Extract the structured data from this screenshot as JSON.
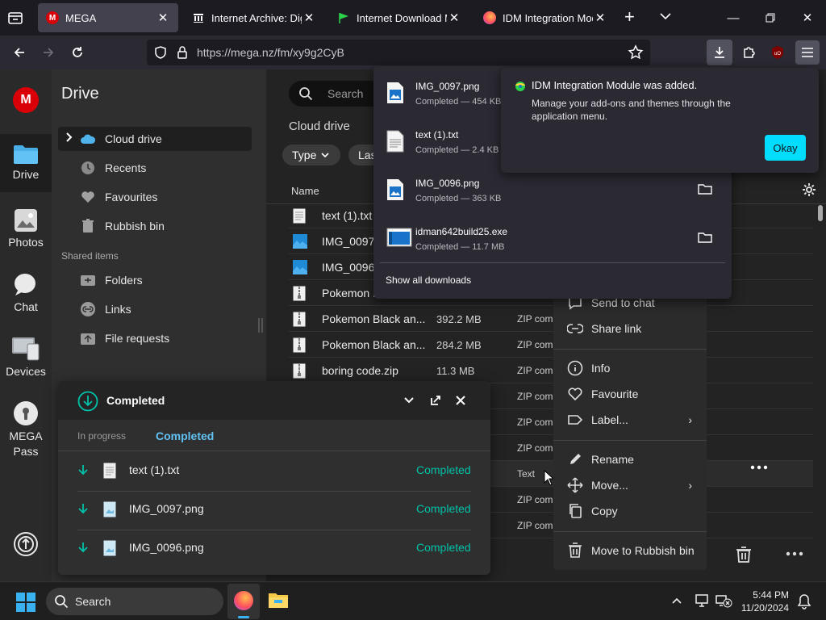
{
  "browser": {
    "tabs": [
      {
        "title": "MEGA",
        "active": true
      },
      {
        "title": "Internet Archive: Digita",
        "active": false
      },
      {
        "title": "Internet Download Ma",
        "active": false
      },
      {
        "title": "IDM Integration Modul",
        "active": false
      }
    ],
    "url": "https://mega.nz/fm/xy9g2CyB"
  },
  "rail": {
    "items": [
      {
        "label": "Drive",
        "icon": "folder-icon"
      },
      {
        "label": "Photos",
        "icon": "photos-icon"
      },
      {
        "label": "Chat",
        "icon": "chat-icon"
      },
      {
        "label": "Devices",
        "icon": "devices-icon"
      },
      {
        "label_line1": "MEGA",
        "label_line2": "Pass",
        "icon": "pass-icon"
      }
    ]
  },
  "sidebar": {
    "title": "Drive",
    "items": [
      {
        "label": "Cloud drive",
        "icon": "cloud-icon"
      },
      {
        "label": "Recents",
        "icon": "clock-icon"
      },
      {
        "label": "Favourites",
        "icon": "heart-icon"
      },
      {
        "label": "Rubbish bin",
        "icon": "trash-icon"
      }
    ],
    "shared_heading": "Shared items",
    "shared_items": [
      {
        "label": "Folders",
        "icon": "shared-folder-icon"
      },
      {
        "label": "Links",
        "icon": "link-icon"
      },
      {
        "label": "File requests",
        "icon": "file-request-icon"
      }
    ]
  },
  "main": {
    "search_placeholder": "Search",
    "breadcrumb": "Cloud drive",
    "filter_type": "Type",
    "filter_last": "Las",
    "col_name": "Name",
    "rows": [
      {
        "name": "text (1).txt",
        "size": "",
        "type": "",
        "icon": "text"
      },
      {
        "name": "IMG_0097",
        "size": "",
        "type": "",
        "icon": "image"
      },
      {
        "name": "IMG_0096",
        "size": "",
        "type": "",
        "icon": "image"
      },
      {
        "name": "Pokemon I",
        "size": "",
        "type": "",
        "icon": "zip"
      },
      {
        "name": "Pokemon Black an...",
        "size": "392.2 MB",
        "type": "ZIP com",
        "icon": "zip"
      },
      {
        "name": "Pokemon Black an...",
        "size": "284.2 MB",
        "type": "ZIP com",
        "icon": "zip"
      },
      {
        "name": "boring code.zip",
        "size": "11.3 MB",
        "type": "ZIP com",
        "icon": "zip"
      },
      {
        "name": "",
        "size": "",
        "type": "ZIP com",
        "icon": ""
      },
      {
        "name": "",
        "size": "",
        "type": "ZIP com",
        "icon": ""
      },
      {
        "name": "",
        "size": "",
        "type": "ZIP com",
        "icon": ""
      },
      {
        "name": "",
        "size": "",
        "type": "Text",
        "icon": ""
      },
      {
        "name": "",
        "size": "",
        "type": "ZIP com",
        "icon": ""
      },
      {
        "name": "",
        "size": "",
        "type": "ZIP com",
        "icon": ""
      }
    ]
  },
  "context_menu": {
    "items": [
      {
        "label": "Send to chat",
        "icon": "send-chat-icon",
        "submenu": false
      },
      {
        "label": "Share link",
        "icon": "link-icon",
        "submenu": false
      },
      {
        "label": "Info",
        "icon": "info-icon",
        "submenu": false
      },
      {
        "label": "Favourite",
        "icon": "heart-icon",
        "submenu": false
      },
      {
        "label": "Label...",
        "icon": "label-icon",
        "submenu": true
      },
      {
        "label": "Rename",
        "icon": "pencil-icon",
        "submenu": false
      },
      {
        "label": "Move...",
        "icon": "move-icon",
        "submenu": true
      },
      {
        "label": "Copy",
        "icon": "copy-icon",
        "submenu": false
      },
      {
        "label": "Move to Rubbish bin",
        "icon": "trash-icon",
        "submenu": false
      }
    ]
  },
  "downloads_panel": {
    "items": [
      {
        "name": "IMG_0097.png",
        "status": "Completed — 454 KB",
        "icon": "image"
      },
      {
        "name": "text (1).txt",
        "status": "Completed — 2.4 KB",
        "icon": "text"
      },
      {
        "name": "IMG_0096.png",
        "status": "Completed — 363 KB",
        "icon": "image"
      },
      {
        "name": "idman642build25.exe",
        "status": "Completed — 11.7 MB",
        "icon": "exe"
      }
    ],
    "show_all": "Show all downloads"
  },
  "notification": {
    "title": "IDM Integration Module was added.",
    "body": "Manage your add-ons and themes through the application menu.",
    "button": "Okay"
  },
  "transfer_panel": {
    "title": "Completed",
    "tab_in_progress": "In progress",
    "tab_completed": "Completed",
    "items": [
      {
        "name": "text (1).txt",
        "status": "Completed",
        "icon": "text"
      },
      {
        "name": "IMG_0097.png",
        "status": "Completed",
        "icon": "image"
      },
      {
        "name": "IMG_0096.png",
        "status": "Completed",
        "icon": "image"
      }
    ]
  },
  "taskbar": {
    "search_label": "Search",
    "time": "5:44 PM",
    "date": "11/20/2024"
  },
  "colors": {
    "mega_red": "#d90007",
    "accent_teal": "#00c2a8",
    "firefox_blue": "#00ddff"
  }
}
